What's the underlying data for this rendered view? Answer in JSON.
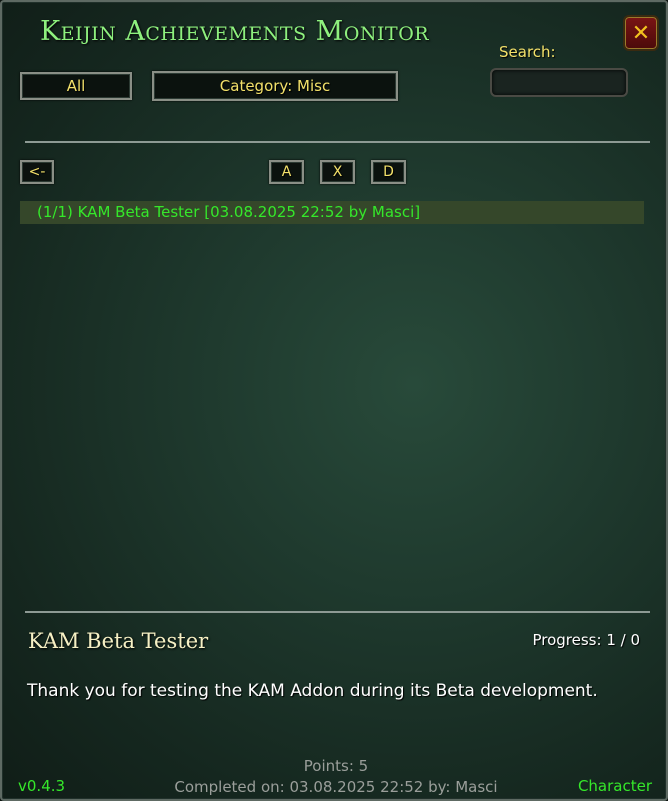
{
  "window": {
    "title": "Keijin Achievements Monitor",
    "close_glyph": "✕"
  },
  "search": {
    "label": "Search:",
    "value": "",
    "placeholder": ""
  },
  "filters": {
    "all_label": "All",
    "category_label": "Category: Misc"
  },
  "toolbar": {
    "back_label": "<-",
    "a_label": "A",
    "x_label": "X",
    "d_label": "D"
  },
  "achievements": [
    {
      "label": "(1/1) KAM Beta Tester [03.08.2025 22:52 by Masci]",
      "completed": true
    }
  ],
  "detail": {
    "name": "KAM Beta Tester",
    "progress": "Progress: 1 / 0",
    "description": "Thank you for testing the KAM Addon during its Beta development.",
    "points": "Points: 5",
    "completed_on": "Completed on: 03.08.2025 22:52 by: Masci"
  },
  "footer": {
    "version": "v0.4.3",
    "character_label": "Character"
  },
  "colors": {
    "title_green": "#8ef07e",
    "gold": "#f3e16a",
    "completed_green": "#35e82a",
    "close_red": "#7a1414"
  },
  "icons": {
    "close": "close-icon"
  }
}
